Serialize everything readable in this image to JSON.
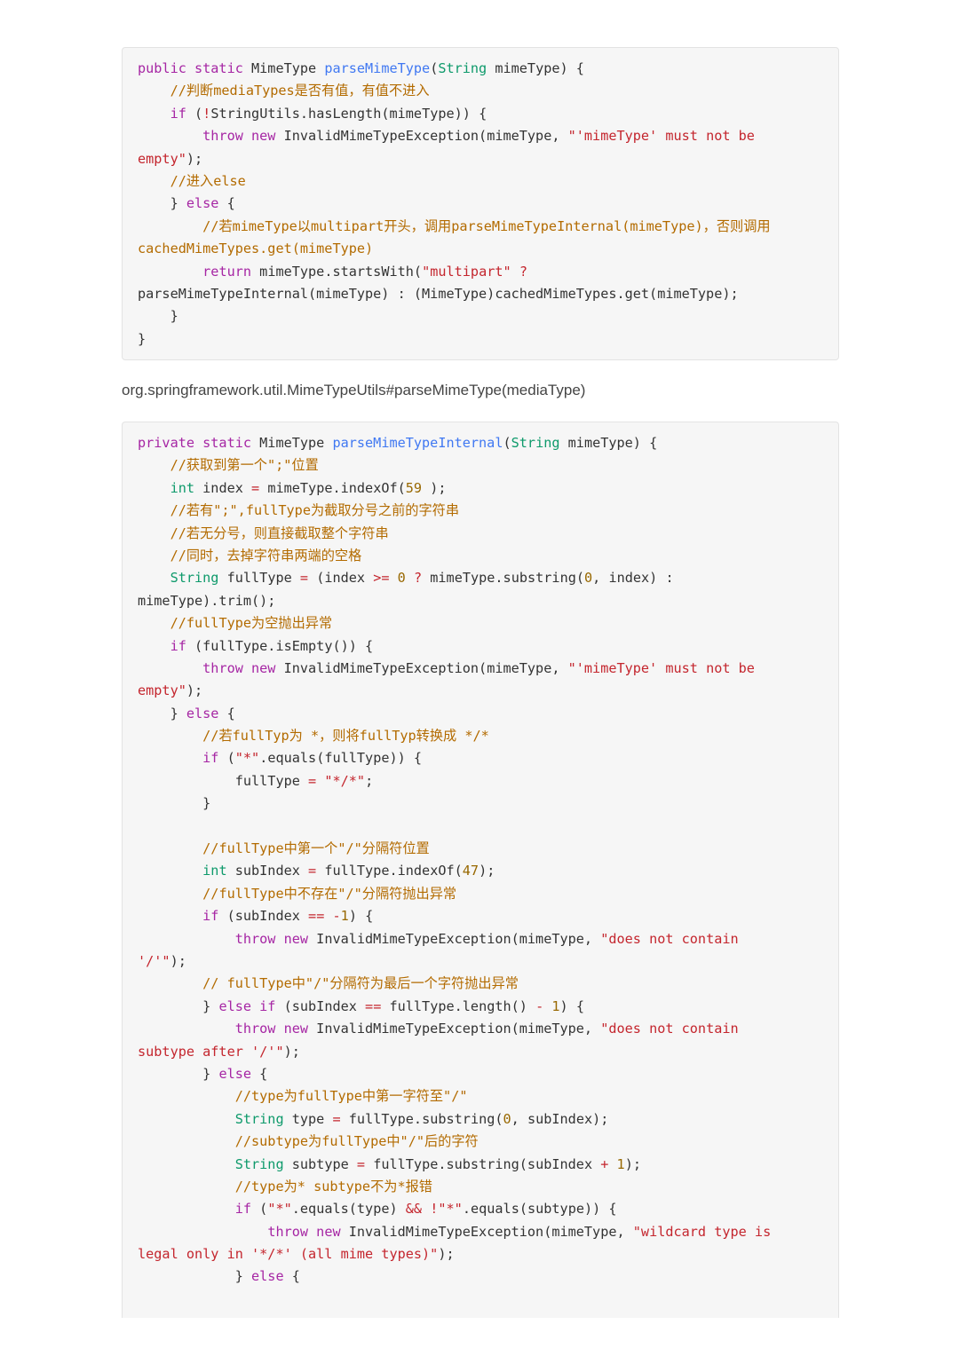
{
  "block1": {
    "lines": [
      [
        [
          "kw",
          "public static "
        ],
        [
          "",
          "MimeType "
        ],
        [
          "fn",
          "parseMimeType"
        ],
        [
          "",
          "("
        ],
        [
          "ty",
          "String"
        ],
        [
          "",
          " mimeType) {"
        ]
      ],
      [
        [
          "",
          "    "
        ],
        [
          "cm",
          "//判断mediaTypes是否有值，有值不进入"
        ]
      ],
      [
        [
          "",
          "    "
        ],
        [
          "kw",
          "if"
        ],
        [
          "",
          " ("
        ],
        [
          "op",
          "!"
        ],
        [
          "",
          "StringUtils.hasLength(mimeType)) {"
        ]
      ],
      [
        [
          "",
          "        "
        ],
        [
          "kw",
          "throw new"
        ],
        [
          "",
          " InvalidMimeTypeException(mimeType, "
        ],
        [
          "st",
          "\"'mimeType' must not be"
        ]
      ],
      [
        [
          "st",
          "empty\""
        ],
        [
          "",
          ");"
        ]
      ],
      [
        [
          "",
          "    "
        ],
        [
          "cm",
          "//进入else"
        ]
      ],
      [
        [
          "",
          "    } "
        ],
        [
          "kw",
          "else"
        ],
        [
          "",
          " {"
        ]
      ],
      [
        [
          "",
          "        "
        ],
        [
          "cm",
          "//若mimeType以multipart开头，调用parseMimeTypeInternal(mimeType)，否则调用"
        ]
      ],
      [
        [
          "cm",
          "cachedMimeTypes.get(mimeType)"
        ]
      ],
      [
        [
          "",
          "        "
        ],
        [
          "kw",
          "return"
        ],
        [
          "",
          " mimeType.startsWith("
        ],
        [
          "st",
          "\"multipart\""
        ],
        [
          "",
          " "
        ],
        [
          "op",
          "?"
        ]
      ],
      [
        [
          "",
          "parseMimeTypeInternal(mimeType) : (MimeType)cachedMimeTypes.get(mimeType);"
        ]
      ],
      [
        [
          "",
          "    }"
        ]
      ],
      [
        [
          "",
          "}"
        ]
      ]
    ]
  },
  "caption": "org.springframework.util.MimeTypeUtils#parseMimeType(mediaType)",
  "block2": {
    "lines": [
      [
        [
          "kw",
          "private static "
        ],
        [
          "",
          "MimeType "
        ],
        [
          "fn",
          "parseMimeTypeInternal"
        ],
        [
          "",
          "("
        ],
        [
          "ty",
          "String"
        ],
        [
          "",
          " mimeType) {"
        ]
      ],
      [
        [
          "",
          "    "
        ],
        [
          "cm",
          "//获取到第一个\";\"位置"
        ]
      ],
      [
        [
          "",
          "    "
        ],
        [
          "ty",
          "int"
        ],
        [
          "",
          " index "
        ],
        [
          "op",
          "="
        ],
        [
          "",
          " mimeType.indexOf("
        ],
        [
          "nm",
          "59"
        ],
        [
          "",
          " );"
        ]
      ],
      [
        [
          "",
          "    "
        ],
        [
          "cm",
          "//若有\";\",fullType为截取分号之前的字符串"
        ]
      ],
      [
        [
          "",
          "    "
        ],
        [
          "cm",
          "//若无分号，则直接截取整个字符串"
        ]
      ],
      [
        [
          "",
          "    "
        ],
        [
          "cm",
          "//同时，去掉字符串两端的空格"
        ]
      ],
      [
        [
          "",
          "    "
        ],
        [
          "ty",
          "String"
        ],
        [
          "",
          " fullType "
        ],
        [
          "op",
          "="
        ],
        [
          "",
          " (index "
        ],
        [
          "op",
          ">="
        ],
        [
          "",
          " "
        ],
        [
          "nm",
          "0"
        ],
        [
          "",
          " "
        ],
        [
          "op",
          "?"
        ],
        [
          "",
          " mimeType.substring("
        ],
        [
          "nm",
          "0"
        ],
        [
          "",
          ", index) :"
        ]
      ],
      [
        [
          "",
          "mimeType).trim();"
        ]
      ],
      [
        [
          "",
          "    "
        ],
        [
          "cm",
          "//fullType为空抛出异常"
        ]
      ],
      [
        [
          "",
          "    "
        ],
        [
          "kw",
          "if"
        ],
        [
          "",
          " (fullType.isEmpty()) {"
        ]
      ],
      [
        [
          "",
          "        "
        ],
        [
          "kw",
          "throw new"
        ],
        [
          "",
          " InvalidMimeTypeException(mimeType, "
        ],
        [
          "st",
          "\"'mimeType' must not be"
        ]
      ],
      [
        [
          "st",
          "empty\""
        ],
        [
          "",
          ");"
        ]
      ],
      [
        [
          "",
          "    } "
        ],
        [
          "kw",
          "else"
        ],
        [
          "",
          " {"
        ]
      ],
      [
        [
          "",
          "        "
        ],
        [
          "cm",
          "//若fullTyp为 *，则将fullTyp转换成 */*"
        ]
      ],
      [
        [
          "",
          "        "
        ],
        [
          "kw",
          "if"
        ],
        [
          "",
          " ("
        ],
        [
          "st",
          "\"*\""
        ],
        [
          "",
          ".equals(fullType)) {"
        ]
      ],
      [
        [
          "",
          "            fullType "
        ],
        [
          "op",
          "="
        ],
        [
          "",
          " "
        ],
        [
          "st",
          "\"*/*\""
        ],
        [
          "",
          ";"
        ]
      ],
      [
        [
          "",
          "        }"
        ]
      ],
      [
        [
          "",
          ""
        ]
      ],
      [
        [
          "",
          "        "
        ],
        [
          "cm",
          "//fullType中第一个\"/\"分隔符位置"
        ]
      ],
      [
        [
          "",
          "        "
        ],
        [
          "ty",
          "int"
        ],
        [
          "",
          " subIndex "
        ],
        [
          "op",
          "="
        ],
        [
          "",
          " fullType.indexOf("
        ],
        [
          "nm",
          "47"
        ],
        [
          "",
          ");"
        ]
      ],
      [
        [
          "",
          "        "
        ],
        [
          "cm",
          "//fullType中不存在\"/\"分隔符抛出异常"
        ]
      ],
      [
        [
          "",
          "        "
        ],
        [
          "kw",
          "if"
        ],
        [
          "",
          " (subIndex "
        ],
        [
          "op",
          "=="
        ],
        [
          "",
          " "
        ],
        [
          "op",
          "-"
        ],
        [
          "nm",
          "1"
        ],
        [
          "",
          ") {"
        ]
      ],
      [
        [
          "",
          "            "
        ],
        [
          "kw",
          "throw new"
        ],
        [
          "",
          " InvalidMimeTypeException(mimeType, "
        ],
        [
          "st",
          "\"does not contain"
        ]
      ],
      [
        [
          "st",
          "'/'\""
        ],
        [
          "",
          ");"
        ]
      ],
      [
        [
          "",
          "        "
        ],
        [
          "cm",
          "// fullType中\"/\"分隔符为最后一个字符抛出异常"
        ]
      ],
      [
        [
          "",
          "        } "
        ],
        [
          "kw",
          "else if"
        ],
        [
          "",
          " (subIndex "
        ],
        [
          "op",
          "=="
        ],
        [
          "",
          " fullType.length() "
        ],
        [
          "op",
          "-"
        ],
        [
          "",
          " "
        ],
        [
          "nm",
          "1"
        ],
        [
          "",
          ") {"
        ]
      ],
      [
        [
          "",
          "            "
        ],
        [
          "kw",
          "throw new"
        ],
        [
          "",
          " InvalidMimeTypeException(mimeType, "
        ],
        [
          "st",
          "\"does not contain"
        ]
      ],
      [
        [
          "st",
          "subtype after '/'\""
        ],
        [
          "",
          ");"
        ]
      ],
      [
        [
          "",
          "        } "
        ],
        [
          "kw",
          "else"
        ],
        [
          "",
          " {"
        ]
      ],
      [
        [
          "",
          "            "
        ],
        [
          "cm",
          "//type为fullType中第一字符至\"/\""
        ]
      ],
      [
        [
          "",
          "            "
        ],
        [
          "ty",
          "String"
        ],
        [
          "",
          " type "
        ],
        [
          "op",
          "="
        ],
        [
          "",
          " fullType.substring("
        ],
        [
          "nm",
          "0"
        ],
        [
          "",
          ", subIndex);"
        ]
      ],
      [
        [
          "",
          "            "
        ],
        [
          "cm",
          "//subtype为fullType中\"/\"后的字符"
        ]
      ],
      [
        [
          "",
          "            "
        ],
        [
          "ty",
          "String"
        ],
        [
          "",
          " subtype "
        ],
        [
          "op",
          "="
        ],
        [
          "",
          " fullType.substring(subIndex "
        ],
        [
          "op",
          "+"
        ],
        [
          "",
          " "
        ],
        [
          "nm",
          "1"
        ],
        [
          "",
          ");"
        ]
      ],
      [
        [
          "",
          "            "
        ],
        [
          "cm",
          "//type为* subtype不为*报错"
        ]
      ],
      [
        [
          "",
          "            "
        ],
        [
          "kw",
          "if"
        ],
        [
          "",
          " ("
        ],
        [
          "st",
          "\"*\""
        ],
        [
          "",
          ".equals(type) "
        ],
        [
          "op",
          "&&"
        ],
        [
          "",
          " "
        ],
        [
          "op",
          "!"
        ],
        [
          "st",
          "\"*\""
        ],
        [
          "",
          ".equals(subtype)) {"
        ]
      ],
      [
        [
          "",
          "                "
        ],
        [
          "kw",
          "throw new"
        ],
        [
          "",
          " InvalidMimeTypeException(mimeType, "
        ],
        [
          "st",
          "\"wildcard type is"
        ]
      ],
      [
        [
          "st",
          "legal only in '*/*' (all mime types)\""
        ],
        [
          "",
          ");"
        ]
      ],
      [
        [
          "",
          "            } "
        ],
        [
          "kw",
          "else"
        ],
        [
          "",
          " {"
        ]
      ]
    ]
  }
}
